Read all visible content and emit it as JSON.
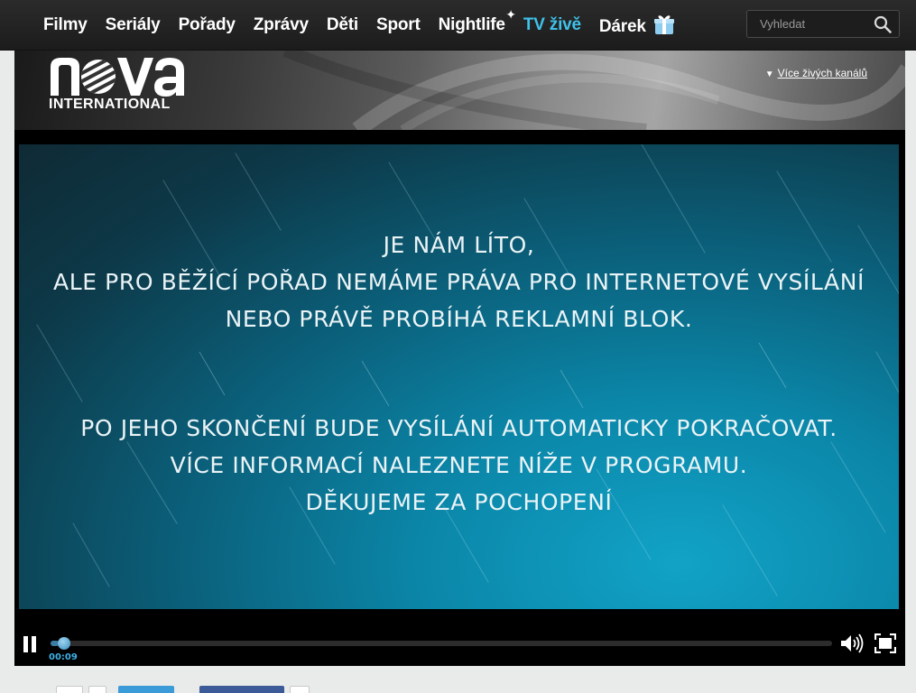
{
  "nav": {
    "items": [
      {
        "label": "Filmy"
      },
      {
        "label": "Seriály"
      },
      {
        "label": "Pořady"
      },
      {
        "label": "Zprávy"
      },
      {
        "label": "Děti"
      },
      {
        "label": "Sport"
      },
      {
        "label": "Nightlife"
      },
      {
        "label": "TV živě"
      },
      {
        "label": "Dárek"
      }
    ],
    "active_item": "TV živě",
    "active_color": "#3fc2ea",
    "search_placeholder": "Vyhledat"
  },
  "channel": {
    "logo_subtitle": "INTERNATIONAL",
    "more_channels_label": "Více živých kanálů"
  },
  "player": {
    "message_lines_1": [
      "JE NÁM LÍTO,",
      "ALE PRO BĚŽÍCÍ POŘAD NEMÁME PRÁVA PRO INTERNETOVÉ VYSÍLÁNÍ",
      "NEBO PRÁVĚ PROBÍHÁ REKLAMNÍ BLOK."
    ],
    "message_lines_2": [
      "PO JEHO SKONČENÍ BUDE VYSÍLÁNÍ AUTOMATICKY POKRAČOVAT.",
      "VÍCE INFORMACÍ NALEZNETE NÍŽE V PROGRAMU.",
      "DĚKUJEME ZA POCHOPENÍ"
    ],
    "time": "00:09",
    "progress_fraction": 0.01,
    "state": "playing"
  },
  "icons": {
    "search": "search-icon",
    "pause": "pause-icon",
    "volume": "volume-icon",
    "fullscreen": "fullscreen-icon",
    "gift": "gift-icon",
    "chevron": "chevron-down-icon"
  }
}
